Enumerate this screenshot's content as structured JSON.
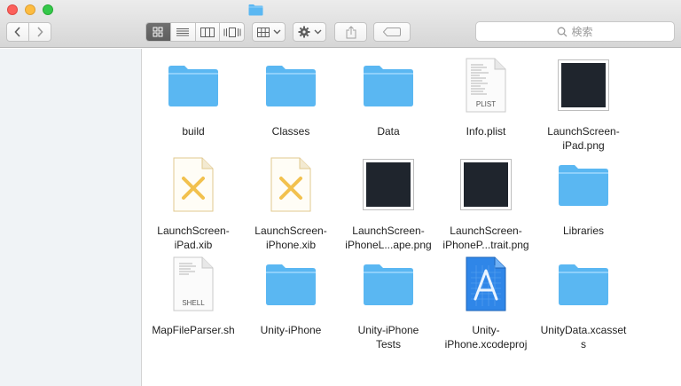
{
  "window": {
    "title_icon": "folder-icon",
    "search_placeholder": "検索"
  },
  "toolbar": {
    "back_icon": "chevron-left-icon",
    "forward_icon": "chevron-right-icon",
    "view_modes": [
      "icon",
      "list",
      "column",
      "cover-flow"
    ],
    "active_view": "icon"
  },
  "colors": {
    "folder": "#5ab7f2",
    "folder_tab": "#8ed0fb",
    "image_thumb": "#1f252d",
    "xib_cross": "#f2c14e"
  },
  "files": [
    {
      "label": "build",
      "kind": "folder"
    },
    {
      "label": "Classes",
      "kind": "folder"
    },
    {
      "label": "Data",
      "kind": "folder"
    },
    {
      "label": "Info.plist",
      "kind": "plist",
      "badge": "PLIST"
    },
    {
      "label": "LaunchScreen-\niPad.png",
      "kind": "image"
    },
    {
      "label": "LaunchScreen-\niPad.xib",
      "kind": "xib"
    },
    {
      "label": "LaunchScreen-\niPhone.xib",
      "kind": "xib"
    },
    {
      "label": "LaunchScreen-\niPhoneL...ape.png",
      "kind": "image"
    },
    {
      "label": "LaunchScreen-\niPhoneP...trait.png",
      "kind": "image"
    },
    {
      "label": "Libraries",
      "kind": "folder"
    },
    {
      "label": "MapFileParser.sh",
      "kind": "shell",
      "badge": "SHELL"
    },
    {
      "label": "Unity-iPhone",
      "kind": "folder"
    },
    {
      "label": "Unity-iPhone\nTests",
      "kind": "folder"
    },
    {
      "label": "Unity-\niPhone.xcodeproj",
      "kind": "xcodeproj"
    },
    {
      "label": "UnityData.xcasset\ns",
      "kind": "folder"
    }
  ]
}
